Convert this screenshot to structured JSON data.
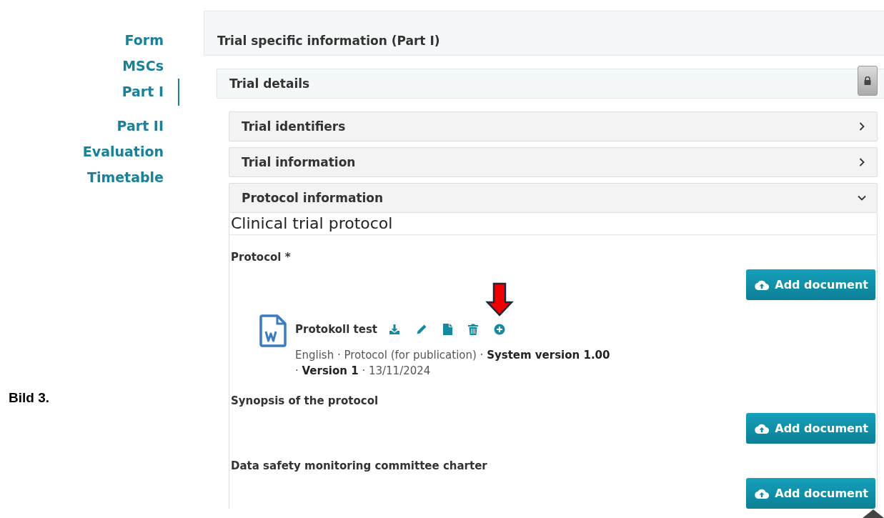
{
  "caption": "Bild 3.",
  "nav": [
    {
      "label": "Form",
      "selected": false
    },
    {
      "label": "MSCs",
      "selected": false
    },
    {
      "label": "Part I",
      "selected": true
    },
    {
      "label": "Part II",
      "selected": false
    },
    {
      "label": "Evaluation",
      "selected": false
    },
    {
      "label": "Timetable",
      "selected": false
    }
  ],
  "panel": {
    "title": "Trial specific information (Part I)",
    "section": {
      "title": "Trial details",
      "locked": true,
      "accordions": [
        {
          "title": "Trial identifiers",
          "expanded": false
        },
        {
          "title": "Trial information",
          "expanded": false
        },
        {
          "title": "Protocol information",
          "expanded": true
        }
      ],
      "content": {
        "heading": "Clinical trial protocol",
        "fields": [
          {
            "label": "Protocol *",
            "button": "Add document",
            "documents": [
              {
                "name": "Protokoll test",
                "meta": "English · Protocol (for publication) · **System version 1.00** · **Version 1** · 13/11/2024"
              }
            ]
          },
          {
            "label": "Synopsis of the protocol",
            "button": "Add document"
          },
          {
            "label": "Data safety monitoring committee charter",
            "button": "Add document"
          }
        ]
      }
    }
  }
}
